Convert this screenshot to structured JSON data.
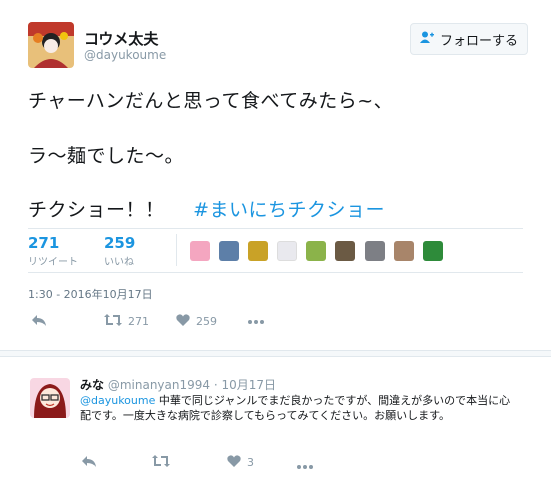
{
  "user": {
    "display_name": "コウメ太夫",
    "handle": "@dayukoume"
  },
  "follow_button": {
    "label": "フォローする"
  },
  "tweet": {
    "line1": "チャーハンだんと思って食べてみたら~、",
    "line2": "ラ～麺でした～。",
    "line3": "チクショー！！",
    "hashtag": "#まいにちチクショー"
  },
  "stats": {
    "retweets": {
      "count": "271",
      "label": "リツイート"
    },
    "likes": {
      "count": "259",
      "label": "いいね"
    }
  },
  "timestamp": "1:30 - 2016年10月17日",
  "actions": {
    "retweet_count": "271",
    "like_count": "259"
  },
  "reply": {
    "name": "みな",
    "handle": "@minanyan1994",
    "separator": "·",
    "date": "10月17日",
    "mention": "@dayukoume",
    "text": " 中華で同じジャンルでまだ良かったですが、間違えが多いので本当に心配です。一度大きな病院で診察してもらってみてください。お願いします。",
    "like_count": "3"
  },
  "colors": {
    "accent": "#1b95e0",
    "muted": "#8899a6",
    "divider": "#e1e8ed"
  },
  "icons": [
    "add-user-icon",
    "reply-icon",
    "retweet-icon",
    "heart-icon",
    "more-icon"
  ]
}
